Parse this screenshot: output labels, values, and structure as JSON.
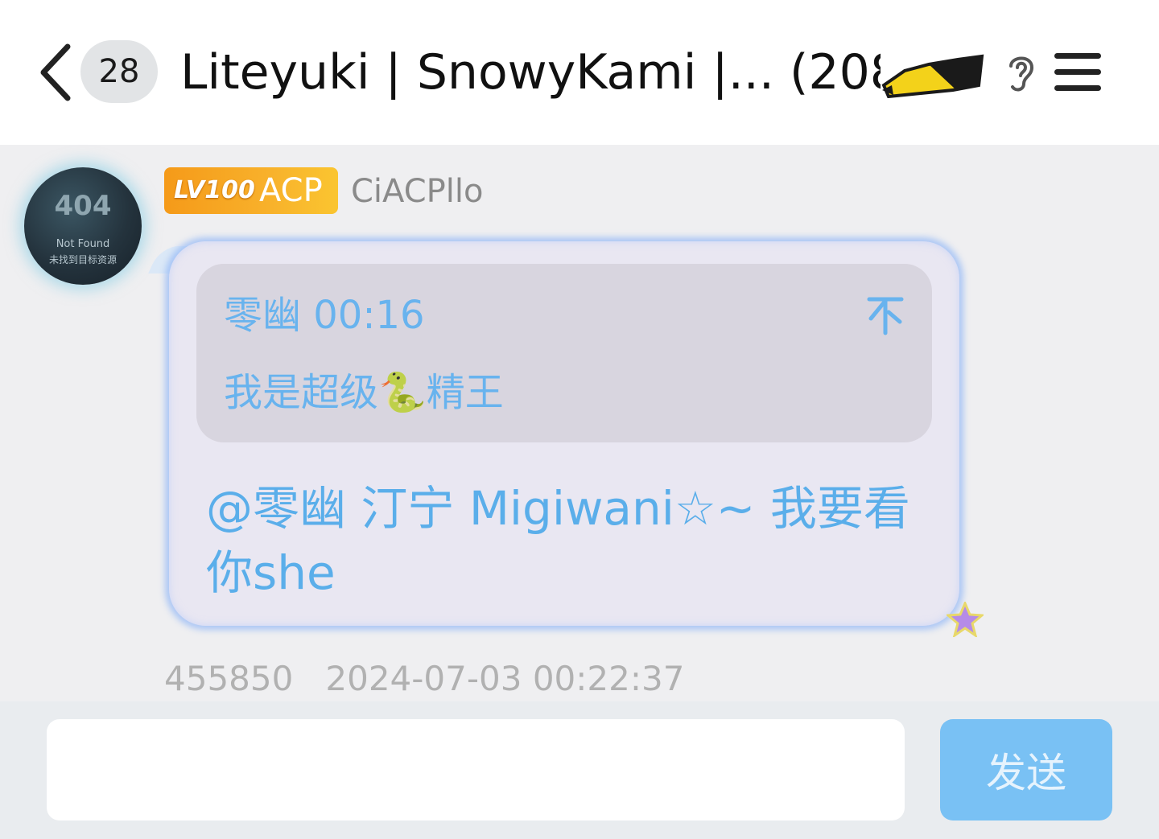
{
  "header": {
    "unread_count": "28",
    "title": "Liteyuki | SnowyKami |... (208)",
    "badge_icon": "hooray-badge",
    "ear_icon": "ear-icon",
    "menu_icon": "menu-icon"
  },
  "message": {
    "avatar": {
      "big_text": "404",
      "line1": "Not Found",
      "line2": "未找到目标资源"
    },
    "level_badge": "LV100",
    "title_badge": "ACP",
    "sender": "CiACPllo",
    "quote": {
      "author_time": "零幽 00:16",
      "text": "我是超级🐍精王"
    },
    "text": "@零幽 汀宁 Migiwani☆~ 我要看你she",
    "meta": "455850   2024-07-03 00:22:37"
  },
  "composer": {
    "input_value": "",
    "send_label": "发送"
  },
  "colors": {
    "accent": "#5aaeea",
    "send_button": "#79c1f4",
    "badge_orange": "#f59a19"
  }
}
